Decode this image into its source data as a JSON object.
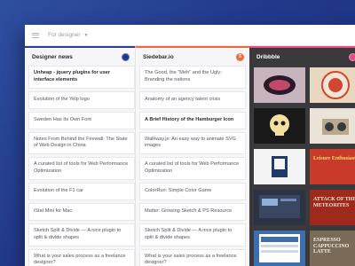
{
  "topbar": {
    "filter_label": "For designer"
  },
  "columns": [
    {
      "title": "Designer news",
      "items": [
        {
          "text": "Unheap - jquery plugins for user interface elements",
          "bold": true
        },
        {
          "text": "Evolution of the Yelp logo",
          "bold": false
        },
        {
          "text": "Sweden Has Its Own Font",
          "bold": false
        },
        {
          "text": "Notes From Behind the Firewall: The State of Web Design in China",
          "bold": false
        },
        {
          "text": "A curated list of tools for Web Performance Optimization",
          "bold": false
        },
        {
          "text": "Evolution of the F1 car",
          "bold": false
        },
        {
          "text": "iStat Mini for Mac",
          "bold": false
        },
        {
          "text": "Sketch Split & Divide — A nice plugin to split & divide shapes",
          "bold": false
        },
        {
          "text": "What is your sales process as a freelance designer?",
          "bold": false
        }
      ]
    },
    {
      "title": "Siedebar.io",
      "badge": "S",
      "items": [
        {
          "text": "The Good, the \"Meh\" and the Ugly: Branding the nations",
          "bold": false
        },
        {
          "text": "Anatomy of an agency talent crisis",
          "bold": false
        },
        {
          "text": "A Brief History of the Hamburger Icon",
          "bold": true
        },
        {
          "text": "Walkway.js: An easy way to animate SVG images",
          "bold": false
        },
        {
          "text": "A curated list of tools for Web Performance Optimization",
          "bold": false
        },
        {
          "text": "ColorRun: Simple Color Game",
          "bold": false
        },
        {
          "text": "Matter: Growing Sketch & PS Resource",
          "bold": false
        },
        {
          "text": "Sketch Split & Divide — A nice plugin to split & divide shapes",
          "bold": false
        },
        {
          "text": "What is your sales process as a freelance designer?",
          "bold": false
        }
      ]
    },
    {
      "title": "Dribbble",
      "shots": [
        {
          "name": "dribbble-shot-lettering",
          "bg": "#c8b4bf",
          "fg": "#2a1a2a",
          "text": ""
        },
        {
          "name": "dribbble-shot-badge",
          "bg": "#e8d8c0",
          "fg": "#d2452e",
          "text": ""
        },
        {
          "name": "dribbble-shot-skull",
          "bg": "#1a1a1a",
          "fg": "#f2e0a0",
          "text": ""
        },
        {
          "name": "dribbble-shot-speaker",
          "bg": "#e9e3d8",
          "fg": "#3a3a3a",
          "text": ""
        },
        {
          "name": "dribbble-shot-usa",
          "bg": "#f4f4f4",
          "fg": "#1f3a6b",
          "text": ""
        },
        {
          "name": "dribbble-shot-leisure",
          "bg": "#c93a2a",
          "fg": "#f4d86a",
          "text": "Leisure Enthusiast"
        },
        {
          "name": "dribbble-shot-dashboard",
          "bg": "#2c3344",
          "fg": "#8fb0d8",
          "text": ""
        },
        {
          "name": "dribbble-shot-meteorites",
          "bg": "#9e2a1e",
          "fg": "#f2e6d0",
          "text": "ATTACK OF THE METEORITES"
        },
        {
          "name": "dribbble-shot-app",
          "bg": "#3d6fb0",
          "fg": "#ffffff",
          "text": ""
        },
        {
          "name": "dribbble-shot-menu",
          "bg": "#7a6a58",
          "fg": "#f5efe4",
          "text": "ESPRESSO CAPPUCCINO LATTE"
        }
      ]
    }
  ]
}
